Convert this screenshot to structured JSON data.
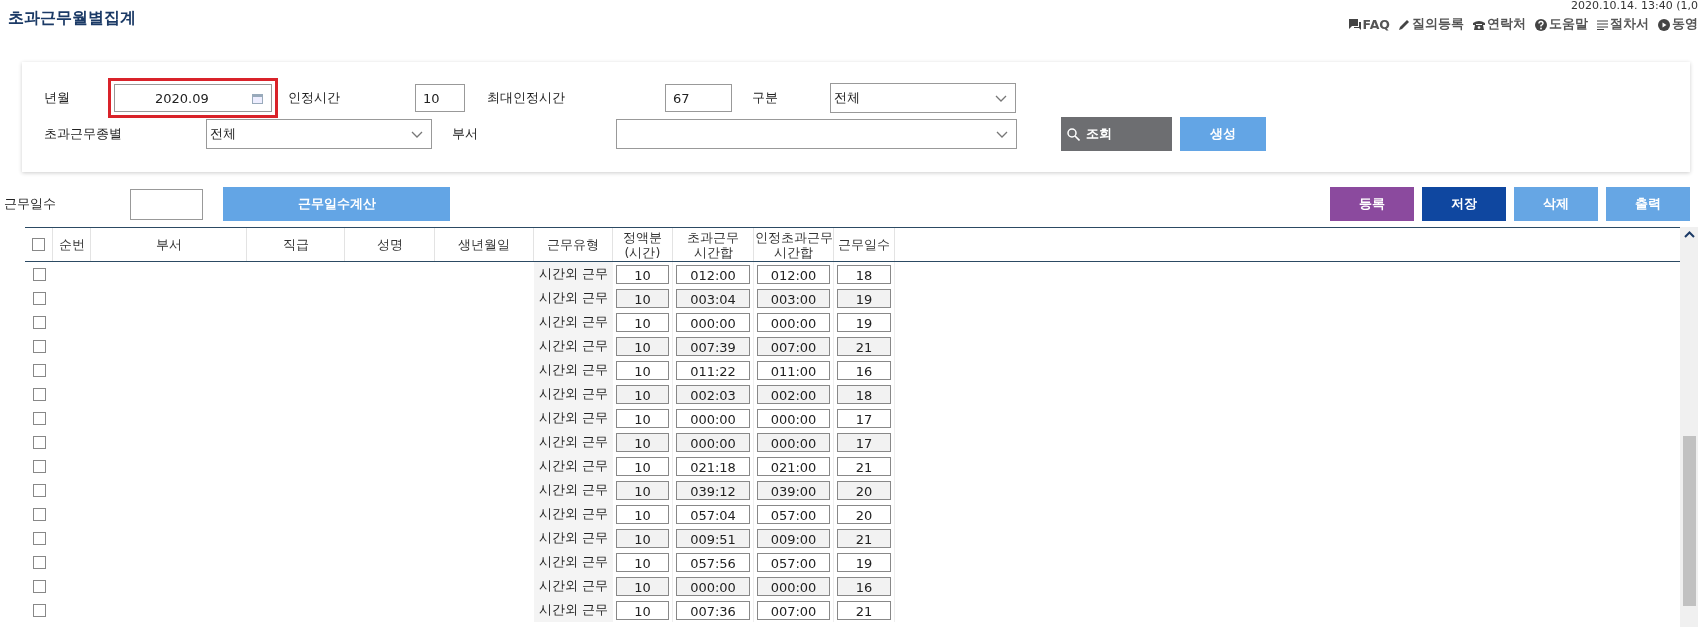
{
  "page_title": "초과근무월별집계",
  "timestamp": "2020.10.14. 13:40 (1,0",
  "header_links": [
    {
      "kind": "faq",
      "label": "FAQ"
    },
    {
      "kind": "write",
      "label": "질의등록"
    },
    {
      "kind": "phone",
      "label": "연락처"
    },
    {
      "kind": "help",
      "label": "도움말"
    },
    {
      "kind": "doc",
      "label": "절차서"
    },
    {
      "kind": "video",
      "label": "동영"
    }
  ],
  "filters": {
    "year_month": {
      "label": "년월",
      "value": "2020.09",
      "highlighted": true
    },
    "recognized_hours": {
      "label": "인정시간",
      "value": "10"
    },
    "max_recognized_hours": {
      "label": "최대인정시간",
      "value": "67"
    },
    "category": {
      "label": "구분",
      "value": "전체"
    },
    "overtime_type": {
      "label": "초과근무종별",
      "value": "전체"
    },
    "department": {
      "label": "부서"
    },
    "search_button": "조회",
    "create_button": "생성"
  },
  "work_days": {
    "label": "근무일수",
    "calc_button": "근무일수계산"
  },
  "action_buttons": [
    {
      "kind": "register",
      "label": "등록"
    },
    {
      "kind": "save",
      "label": "저장"
    },
    {
      "kind": "delete",
      "label": "삭제"
    },
    {
      "kind": "print",
      "label": "출력"
    }
  ],
  "table": {
    "all_checked": false,
    "columns": [
      "순번",
      "부서",
      "직급",
      "성명",
      "생년월일",
      "근무유형",
      "정액분\n(시간)",
      "초과근무\n시간합",
      "인정초과근무\n시간합",
      "근무일수"
    ],
    "rows": [
      {
        "checked": false,
        "type": "시간외 근무",
        "fixed": "10",
        "overtime": "012:00",
        "recognized": "012:00",
        "days": "18"
      },
      {
        "checked": false,
        "type": "시간외 근무",
        "fixed": "10",
        "overtime": "003:04",
        "recognized": "003:00",
        "days": "19"
      },
      {
        "checked": false,
        "type": "시간외 근무",
        "fixed": "10",
        "overtime": "000:00",
        "recognized": "000:00",
        "days": "19"
      },
      {
        "checked": false,
        "type": "시간외 근무",
        "fixed": "10",
        "overtime": "007:39",
        "recognized": "007:00",
        "days": "21"
      },
      {
        "checked": false,
        "type": "시간외 근무",
        "fixed": "10",
        "overtime": "011:22",
        "recognized": "011:00",
        "days": "16"
      },
      {
        "checked": false,
        "type": "시간외 근무",
        "fixed": "10",
        "overtime": "002:03",
        "recognized": "002:00",
        "days": "18"
      },
      {
        "checked": false,
        "type": "시간외 근무",
        "fixed": "10",
        "overtime": "000:00",
        "recognized": "000:00",
        "days": "17"
      },
      {
        "checked": false,
        "type": "시간외 근무",
        "fixed": "10",
        "overtime": "000:00",
        "recognized": "000:00",
        "days": "17"
      },
      {
        "checked": false,
        "type": "시간외 근무",
        "fixed": "10",
        "overtime": "021:18",
        "recognized": "021:00",
        "days": "21"
      },
      {
        "checked": false,
        "type": "시간외 근무",
        "fixed": "10",
        "overtime": "039:12",
        "recognized": "039:00",
        "days": "20"
      },
      {
        "checked": false,
        "type": "시간외 근무",
        "fixed": "10",
        "overtime": "057:04",
        "recognized": "057:00",
        "days": "20"
      },
      {
        "checked": false,
        "type": "시간외 근무",
        "fixed": "10",
        "overtime": "009:51",
        "recognized": "009:00",
        "days": "21"
      },
      {
        "checked": false,
        "type": "시간외 근무",
        "fixed": "10",
        "overtime": "057:56",
        "recognized": "057:00",
        "days": "19"
      },
      {
        "checked": false,
        "type": "시간외 근무",
        "fixed": "10",
        "overtime": "000:00",
        "recognized": "000:00",
        "days": "16"
      },
      {
        "checked": false,
        "type": "시간외 근무",
        "fixed": "10",
        "overtime": "007:36",
        "recognized": "007:00",
        "days": "21"
      }
    ]
  }
}
